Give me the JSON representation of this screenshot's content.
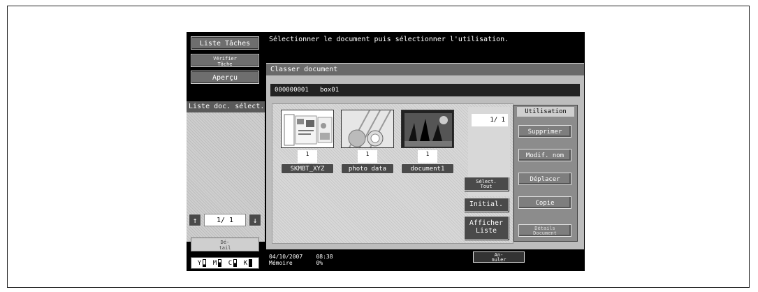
{
  "left": {
    "liste_taches": "Liste Tâches",
    "verifier_tache": "Vérifier\nTâche",
    "apercu": "Aperçu",
    "liste_doc_select": "Liste doc. sélect.",
    "pager": "1/ 1",
    "detail": "Dé-\ntail",
    "toner": [
      "Y",
      "M",
      "C",
      "K"
    ]
  },
  "message": "Sélectionner le document puis sélectionner l'utilisation.",
  "main": {
    "header": "Classer document",
    "box_id": "000000001",
    "box_name": "box01",
    "documents": [
      {
        "name": "SKMBT_XYZ",
        "count": "1"
      },
      {
        "name": "photo data",
        "count": "1"
      },
      {
        "name": "document1",
        "count": "1"
      }
    ],
    "page": "1/ 1",
    "select_all": "Sélect.\nTout",
    "initial": "Initial.",
    "afficher_liste": "Afficher\nListe"
  },
  "utilisation": {
    "title": "Utilisation",
    "supprimer": "Supprimer",
    "modif_nom": "Modif. nom",
    "deplacer": "Déplacer",
    "copie": "Copie",
    "details": "Détails\nDocument"
  },
  "footer": {
    "date": "04/10/2007",
    "time": "08:38",
    "memory_label": "Mémoire",
    "memory_value": "0%",
    "annuler": "An-\nnuler"
  }
}
